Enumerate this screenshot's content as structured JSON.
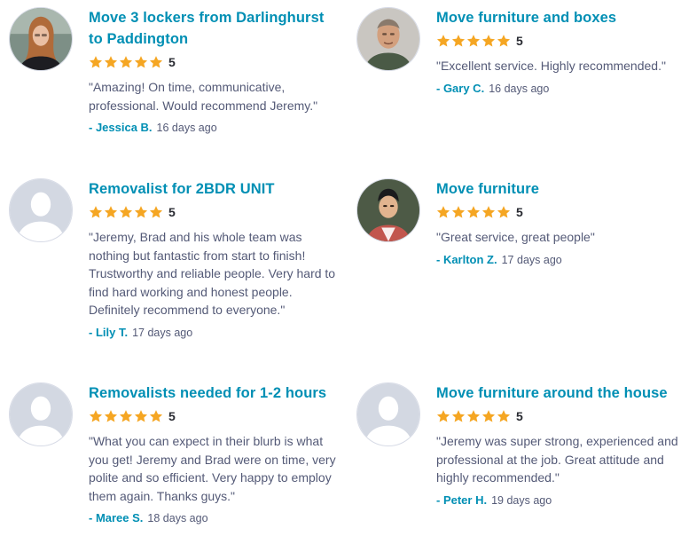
{
  "star_color": "#f5a623",
  "accent_color": "#008fb4",
  "reviews": [
    {
      "title": "Move 3 lockers from Darlinghurst to Paddington",
      "rating": "5",
      "quote": "\"Amazing! On time, communicative, professional. Would recommend Jeremy.\"",
      "author": "- Jessica B.",
      "time": "16 days ago",
      "avatar": "photo-woman-icon"
    },
    {
      "title": "Move furniture and boxes",
      "rating": "5",
      "quote": "\"Excellent service. Highly recommended.\"",
      "author": "- Gary C.",
      "time": "16 days ago",
      "avatar": "photo-man-icon"
    },
    {
      "title": "Removalist for 2BDR UNIT",
      "rating": "5",
      "quote": "\"Jeremy, Brad and his whole team was nothing but fantastic from start to finish! Trustworthy and reliable people. Very hard to find hard working and honest people. Definitely recommend to everyone.\"",
      "author": "- Lily T.",
      "time": "17 days ago",
      "avatar": "default-avatar-icon"
    },
    {
      "title": "Move furniture",
      "rating": "5",
      "quote": "\"Great service, great people\"",
      "author": "- Karlton Z.",
      "time": "17 days ago",
      "avatar": "photo-man-icon"
    },
    {
      "title": "Removalists needed for 1-2 hours",
      "rating": "5",
      "quote": "\"What you can expect in their blurb is what you get! Jeremy and Brad were on time, very polite and so efficient. Very happy to employ them again. Thanks guys.\"",
      "author": "- Maree S.",
      "time": "18 days ago",
      "avatar": "default-avatar-icon"
    },
    {
      "title": "Move furniture around the house",
      "rating": "5",
      "quote": "\"Jeremy was super strong, experienced and professional at the job. Great attitude and highly recommended.\"",
      "author": "- Peter H.",
      "time": "19 days ago",
      "avatar": "default-avatar-icon"
    }
  ]
}
